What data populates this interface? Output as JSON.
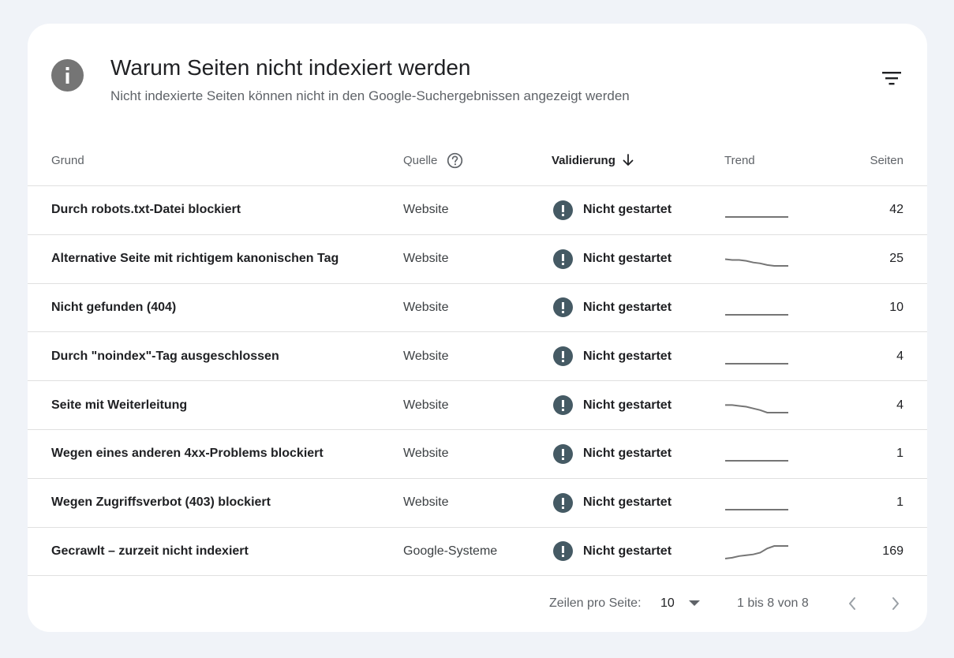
{
  "header": {
    "title": "Warum Seiten nicht indexiert werden",
    "subtitle": "Nicht indexierte Seiten können nicht in den Google-Suchergebnissen angezeigt werden",
    "icon": "info-icon",
    "filter_icon": "filter-icon"
  },
  "columns": {
    "grund": "Grund",
    "quelle": "Quelle",
    "validierung": "Validierung",
    "trend": "Trend",
    "seiten": "Seiten"
  },
  "rows": [
    {
      "grund": "Durch robots.txt-Datei blockiert",
      "quelle": "Website",
      "validierung": "Nicht gestartet",
      "seiten": "42",
      "trend": [
        0,
        0,
        0,
        0,
        0,
        0,
        0,
        0,
        0,
        0
      ]
    },
    {
      "grund": "Alternative Seite mit richtigem kanonischen Tag",
      "quelle": "Website",
      "validierung": "Nicht gestartet",
      "seiten": "25",
      "trend": [
        8,
        7,
        7,
        6,
        4,
        3,
        1,
        0,
        0,
        0
      ]
    },
    {
      "grund": "Nicht gefunden (404)",
      "quelle": "Website",
      "validierung": "Nicht gestartet",
      "seiten": "10",
      "trend": [
        0,
        0,
        0,
        0,
        0,
        0,
        0,
        0,
        0,
        0
      ]
    },
    {
      "grund": "Durch \"noindex\"-Tag ausgeschlossen",
      "quelle": "Website",
      "validierung": "Nicht gestartet",
      "seiten": "4",
      "trend": [
        0,
        0,
        0,
        0,
        0,
        0,
        0,
        0,
        0,
        0
      ]
    },
    {
      "grund": "Seite mit Weiterleitung",
      "quelle": "Website",
      "validierung": "Nicht gestartet",
      "seiten": "4",
      "trend": [
        9,
        9,
        8,
        7,
        5,
        3,
        0,
        0,
        0,
        0
      ]
    },
    {
      "grund": "Wegen eines anderen 4xx-Problems blockiert",
      "quelle": "Website",
      "validierung": "Nicht gestartet",
      "seiten": "1",
      "trend": [
        0,
        0,
        0,
        0,
        0,
        0,
        0,
        0,
        0,
        0
      ]
    },
    {
      "grund": "Wegen Zugriffsverbot (403) blockiert",
      "quelle": "Website",
      "validierung": "Nicht gestartet",
      "seiten": "1",
      "trend": [
        0,
        0,
        0,
        0,
        0,
        0,
        0,
        0,
        0,
        0
      ]
    },
    {
      "grund": "Gecrawlt – zurzeit nicht indexiert",
      "quelle": "Google-Systeme",
      "validierung": "Nicht gestartet",
      "seiten": "169",
      "trend": [
        0,
        1,
        3,
        4,
        5,
        7,
        12,
        15,
        15,
        15
      ]
    }
  ],
  "footer": {
    "rows_per_page_label": "Zeilen pro Seite:",
    "rows_per_page_value": "10",
    "range": "1 bis 8 von 8"
  },
  "colors": {
    "accent_warning": "#455a64",
    "trend_line": "#757575"
  }
}
